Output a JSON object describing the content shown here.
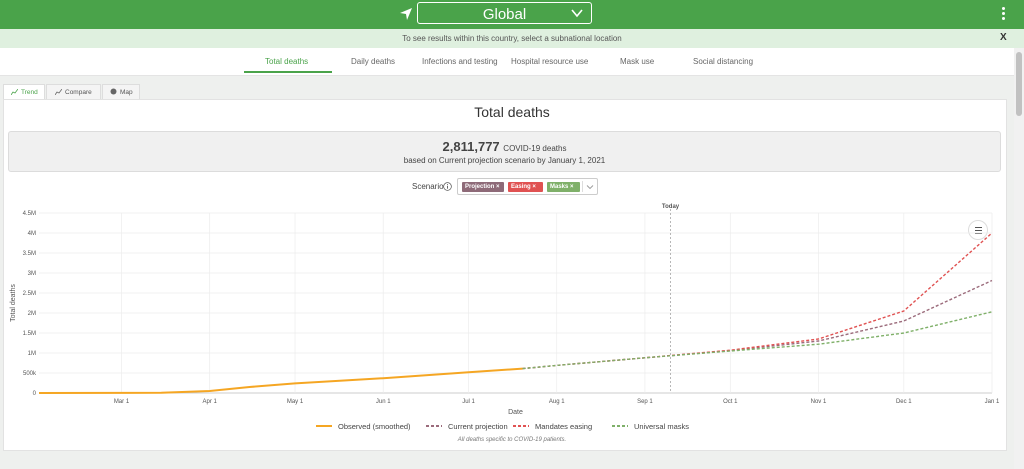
{
  "header": {
    "location": "Global"
  },
  "notice": {
    "message": "To see results within this country, select a subnational location",
    "close_label": "X"
  },
  "tabs": [
    "Total deaths",
    "Daily deaths",
    "Infections and testing",
    "Hospital resource use",
    "Mask use",
    "Social distancing"
  ],
  "subtabs": [
    "Trend",
    "Compare",
    "Map"
  ],
  "card": {
    "title": "Total deaths",
    "total": "2,811,777",
    "total_unit": "COVID-19 deaths",
    "summary_line2": "based on Current projection scenario by January 1, 2021",
    "scenario_label": "Scenario",
    "scenarios": [
      "Projection",
      "Easing",
      "Masks"
    ],
    "chip_x": "×",
    "footnote": "All deaths specific to COVID-19 patients."
  },
  "colors": {
    "brand": "#4aa34a",
    "observed": "#f5a623",
    "projection": "#9b6b7b",
    "easing": "#e05252",
    "masks": "#7fb069"
  },
  "chart_data": {
    "type": "line",
    "xlabel": "Date",
    "ylabel": "Total deaths",
    "x_ticks": [
      "Mar 1",
      "Apr 1",
      "May 1",
      "Jun 1",
      "Jul 1",
      "Aug 1",
      "Sep 1",
      "Oct 1",
      "Nov 1",
      "Dec 1",
      "Jan 1"
    ],
    "y_ticks": [
      "0",
      "500k",
      "1M",
      "1.5M",
      "2M",
      "2.5M",
      "3M",
      "3.5M",
      "4M",
      "4.5M"
    ],
    "ylim": [
      0,
      4500000
    ],
    "xlim": [
      "2020-02-01",
      "2021-01-01"
    ],
    "today_label": "Today",
    "today_date": "2020-09-10",
    "series": [
      {
        "name": "Observed (smoothed)",
        "style": "solid",
        "points": [
          [
            "2020-02-01",
            0
          ],
          [
            "2020-03-01",
            2000
          ],
          [
            "2020-03-15",
            8000
          ],
          [
            "2020-04-01",
            50000
          ],
          [
            "2020-04-15",
            150000
          ],
          [
            "2020-05-01",
            240000
          ],
          [
            "2020-06-01",
            370000
          ],
          [
            "2020-07-01",
            520000
          ],
          [
            "2020-07-20",
            610000
          ]
        ]
      },
      {
        "name": "Current projection",
        "style": "dashed",
        "points": [
          [
            "2020-07-20",
            610000
          ],
          [
            "2020-08-01",
            690000
          ],
          [
            "2020-09-01",
            880000
          ],
          [
            "2020-10-01",
            1060000
          ],
          [
            "2020-11-01",
            1300000
          ],
          [
            "2020-12-01",
            1800000
          ],
          [
            "2021-01-01",
            2811777
          ]
        ]
      },
      {
        "name": "Mandates easing",
        "style": "dashed",
        "points": [
          [
            "2020-07-20",
            610000
          ],
          [
            "2020-08-01",
            690000
          ],
          [
            "2020-09-01",
            880000
          ],
          [
            "2020-10-01",
            1070000
          ],
          [
            "2020-11-01",
            1350000
          ],
          [
            "2020-12-01",
            2050000
          ],
          [
            "2021-01-01",
            4000000
          ]
        ]
      },
      {
        "name": "Universal masks",
        "style": "dashed",
        "points": [
          [
            "2020-07-20",
            610000
          ],
          [
            "2020-08-01",
            690000
          ],
          [
            "2020-09-01",
            880000
          ],
          [
            "2020-10-01",
            1050000
          ],
          [
            "2020-11-01",
            1220000
          ],
          [
            "2020-12-01",
            1500000
          ],
          [
            "2021-01-01",
            2030000
          ]
        ]
      }
    ]
  }
}
